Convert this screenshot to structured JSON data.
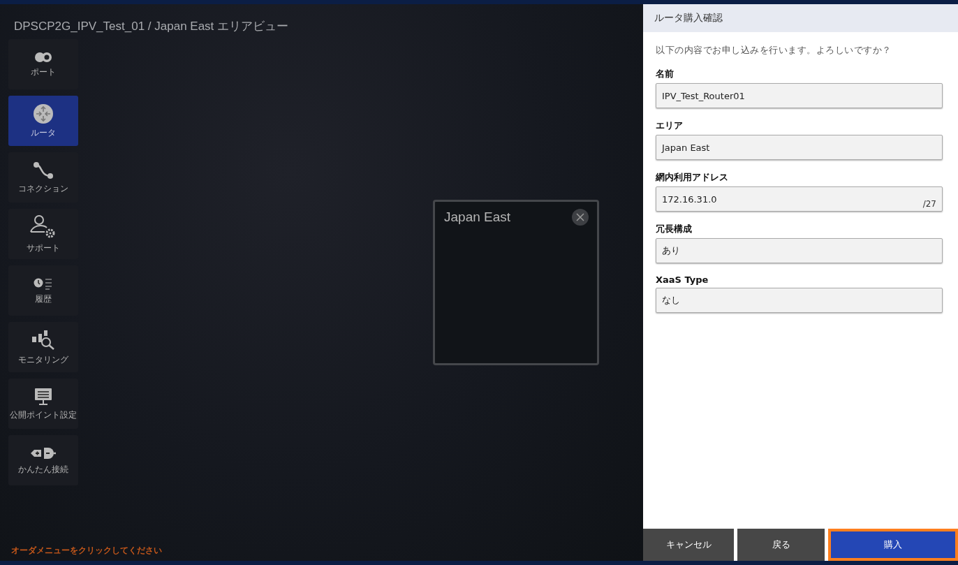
{
  "page_title": "DPSCP2G_IPV_Test_01 / Japan East エリアビュー",
  "sidebar": {
    "items": [
      {
        "kind": "port",
        "label": "ポート",
        "selected": false
      },
      {
        "kind": "router",
        "label": "ルータ",
        "selected": true
      },
      {
        "kind": "connection",
        "label": "コネクション",
        "selected": false
      },
      {
        "kind": "support",
        "label": "サポート",
        "selected": false
      },
      {
        "kind": "history",
        "label": "履歴",
        "selected": false
      },
      {
        "kind": "monitoring",
        "label": "モニタリング",
        "selected": false
      },
      {
        "kind": "public-point",
        "label": "公開ポイント設定",
        "selected": false
      },
      {
        "kind": "easy-connect",
        "label": "かんたん接続",
        "selected": false
      }
    ]
  },
  "area_card": {
    "title": "Japan East"
  },
  "hint": "オーダメニューをクリックしてください",
  "dialog": {
    "title": "ルータ購入確認",
    "message": "以下の内容でお申し込みを行います。よろしいですか？",
    "fields": [
      {
        "label": "名前",
        "value": "IPV_Test_Router01"
      },
      {
        "label": "エリア",
        "value": "Japan East"
      },
      {
        "label": "網内利用アドレス",
        "value": "172.16.31.0",
        "suffix": "/27"
      },
      {
        "label": "冗長構成",
        "value": "あり"
      },
      {
        "label": "XaaS Type",
        "value": "なし"
      }
    ],
    "buttons": [
      {
        "kind": "secondary",
        "label": "キャンセル",
        "focused": false
      },
      {
        "kind": "secondary",
        "label": "戻る",
        "focused": false
      },
      {
        "kind": "primary",
        "label": "購入",
        "focused": true
      }
    ]
  }
}
